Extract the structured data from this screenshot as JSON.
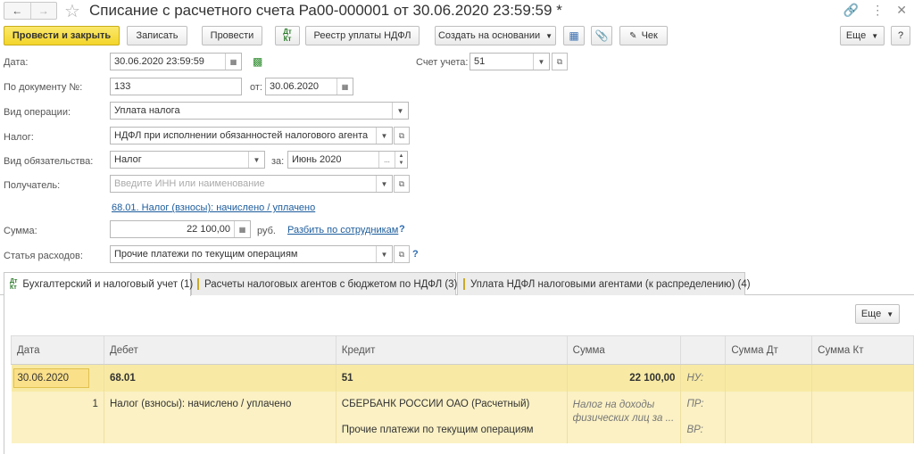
{
  "header": {
    "title": "Списание с расчетного счета Ра00-000001 от 30.06.2020 23:59:59 *"
  },
  "toolbar": {
    "post_close": "Провести и закрыть",
    "save": "Записать",
    "post": "Провести",
    "ndfl_registry": "Реестр уплаты НДФЛ",
    "create_based": "Создать на основании",
    "check": "Чек",
    "more": "Еще",
    "help": "?"
  },
  "form": {
    "date_label": "Дата:",
    "date_value": "30.06.2020 23:59:59",
    "account_label": "Счет учета:",
    "account_value": "51",
    "doc_label": "По документу №:",
    "doc_number": "133",
    "from_label": "от:",
    "from_date": "30.06.2020",
    "operation_label": "Вид операции:",
    "operation_value": "Уплата налога",
    "tax_label": "Налог:",
    "tax_value": "НДФЛ при исполнении обязанностей налогового агента",
    "obligation_label": "Вид обязательства:",
    "obligation_value": "Налог",
    "for_label": "за:",
    "period_value": "Июнь 2020",
    "recipient_label": "Получатель:",
    "recipient_placeholder": "Введите ИНН или наименование",
    "account_link": "68.01. Налог (взносы): начислено / уплачено",
    "amount_label": "Сумма:",
    "amount_value": "22 100,00",
    "currency": "руб.",
    "split_link": "Разбить по сотрудникам",
    "expense_label": "Статья расходов:",
    "expense_value": "Прочие платежи по текущим операциям",
    "help_mark": "?"
  },
  "tabs": [
    {
      "label": "Бухгалтерский и налоговый учет (1)",
      "icon": "dt-kt-icon"
    },
    {
      "label": "Расчеты налоговых агентов с бюджетом по НДФЛ (3)",
      "icon": "document-icon"
    },
    {
      "label": "Уплата НДФЛ налоговыми агентами (к распределению) (4)",
      "icon": "document-icon"
    }
  ],
  "table": {
    "more": "Еще",
    "columns": [
      "Дата",
      "Дебет",
      "Кредит",
      "Сумма",
      "",
      "Сумма Дт",
      "Сумма Кт"
    ],
    "row": {
      "date": "30.06.2020",
      "debit": "68.01",
      "credit": "51",
      "amount": "22 100,00",
      "nu": "НУ:",
      "line_no": "1",
      "debit_sub": "Налог (взносы): начислено / уплачено",
      "credit_sub1": "СБЕРБАНК РОССИИ ОАО (Расчетный)",
      "content_1": "Налог на доходы",
      "content_2": "физических лиц за ...",
      "pr": "ПР:",
      "credit_sub2": "Прочие платежи по текущим операциям",
      "vr": "ВР:"
    }
  }
}
